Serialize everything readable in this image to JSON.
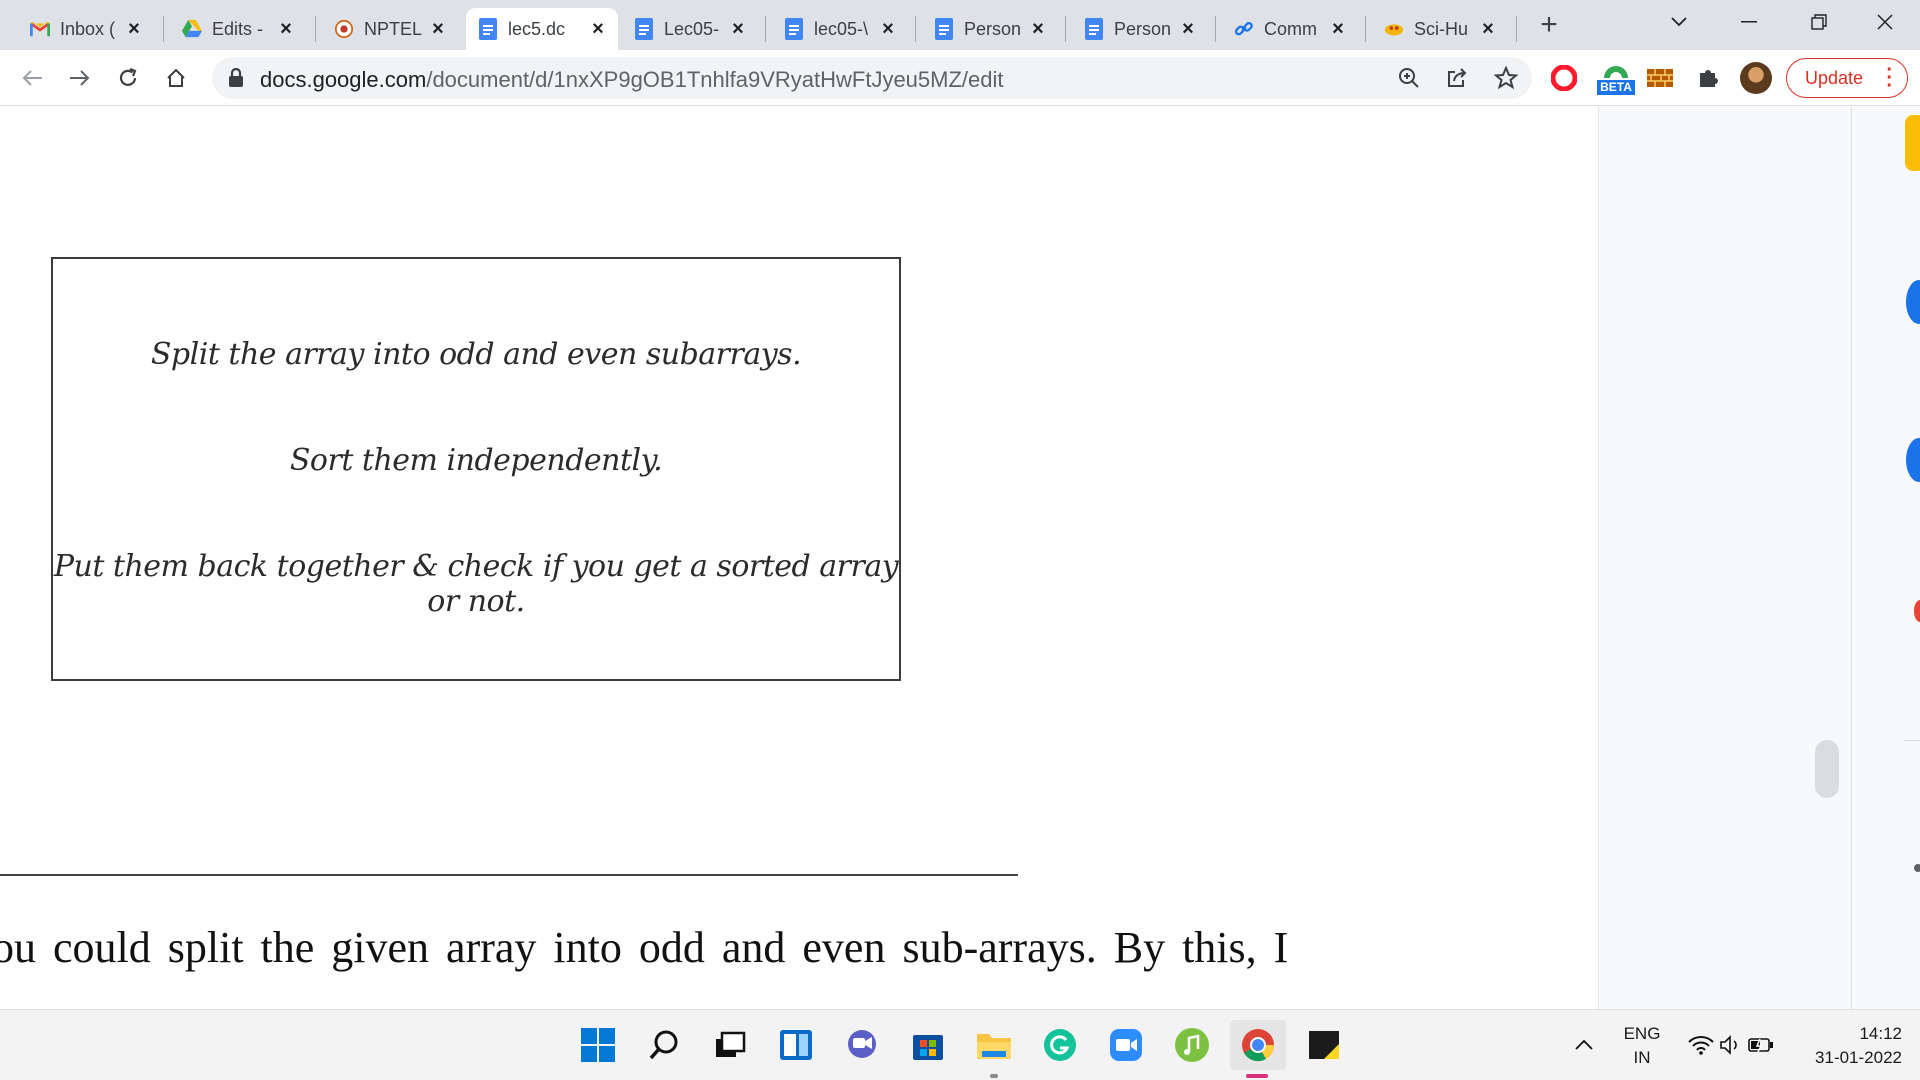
{
  "browser": {
    "tabs": [
      {
        "title": "Inbox (",
        "icon": "gmail-icon",
        "active": false
      },
      {
        "title": "Edits -",
        "icon": "google-drive-icon",
        "active": false
      },
      {
        "title": "NPTEL",
        "icon": "nptel-icon",
        "active": false
      },
      {
        "title": "lec5.dc",
        "icon": "google-docs-icon",
        "active": true
      },
      {
        "title": "Lec05-",
        "icon": "google-docs-icon",
        "active": false
      },
      {
        "title": "lec05-\\",
        "icon": "google-docs-icon",
        "active": false
      },
      {
        "title": "Person",
        "icon": "google-docs-icon",
        "active": false
      },
      {
        "title": "Person",
        "icon": "google-docs-icon",
        "active": false
      },
      {
        "title": "Comm",
        "icon": "link-icon",
        "active": false
      },
      {
        "title": "Sci-Hu",
        "icon": "scihub-icon",
        "active": false
      }
    ],
    "url_host": "docs.google.com",
    "url_path": "/document/d/1nxXP9gOB1Tnhlfa9VRyatHwFtJyeu5MZ/edit",
    "update_label": "Update",
    "beta_badge": "BETA",
    "accent_color": "#d93025"
  },
  "document": {
    "figure_lines": [
      "Split the array into odd and even subarrays.",
      "Sort them independently.",
      "Put them back together & check if you get a sorted array or not."
    ],
    "body_text": "ou could split the given array into odd and even sub-arrays. By this, I"
  },
  "taskbar": {
    "lang_top": "ENG",
    "lang_bottom": "IN",
    "time": "14:12",
    "date": "31-01-2022"
  }
}
